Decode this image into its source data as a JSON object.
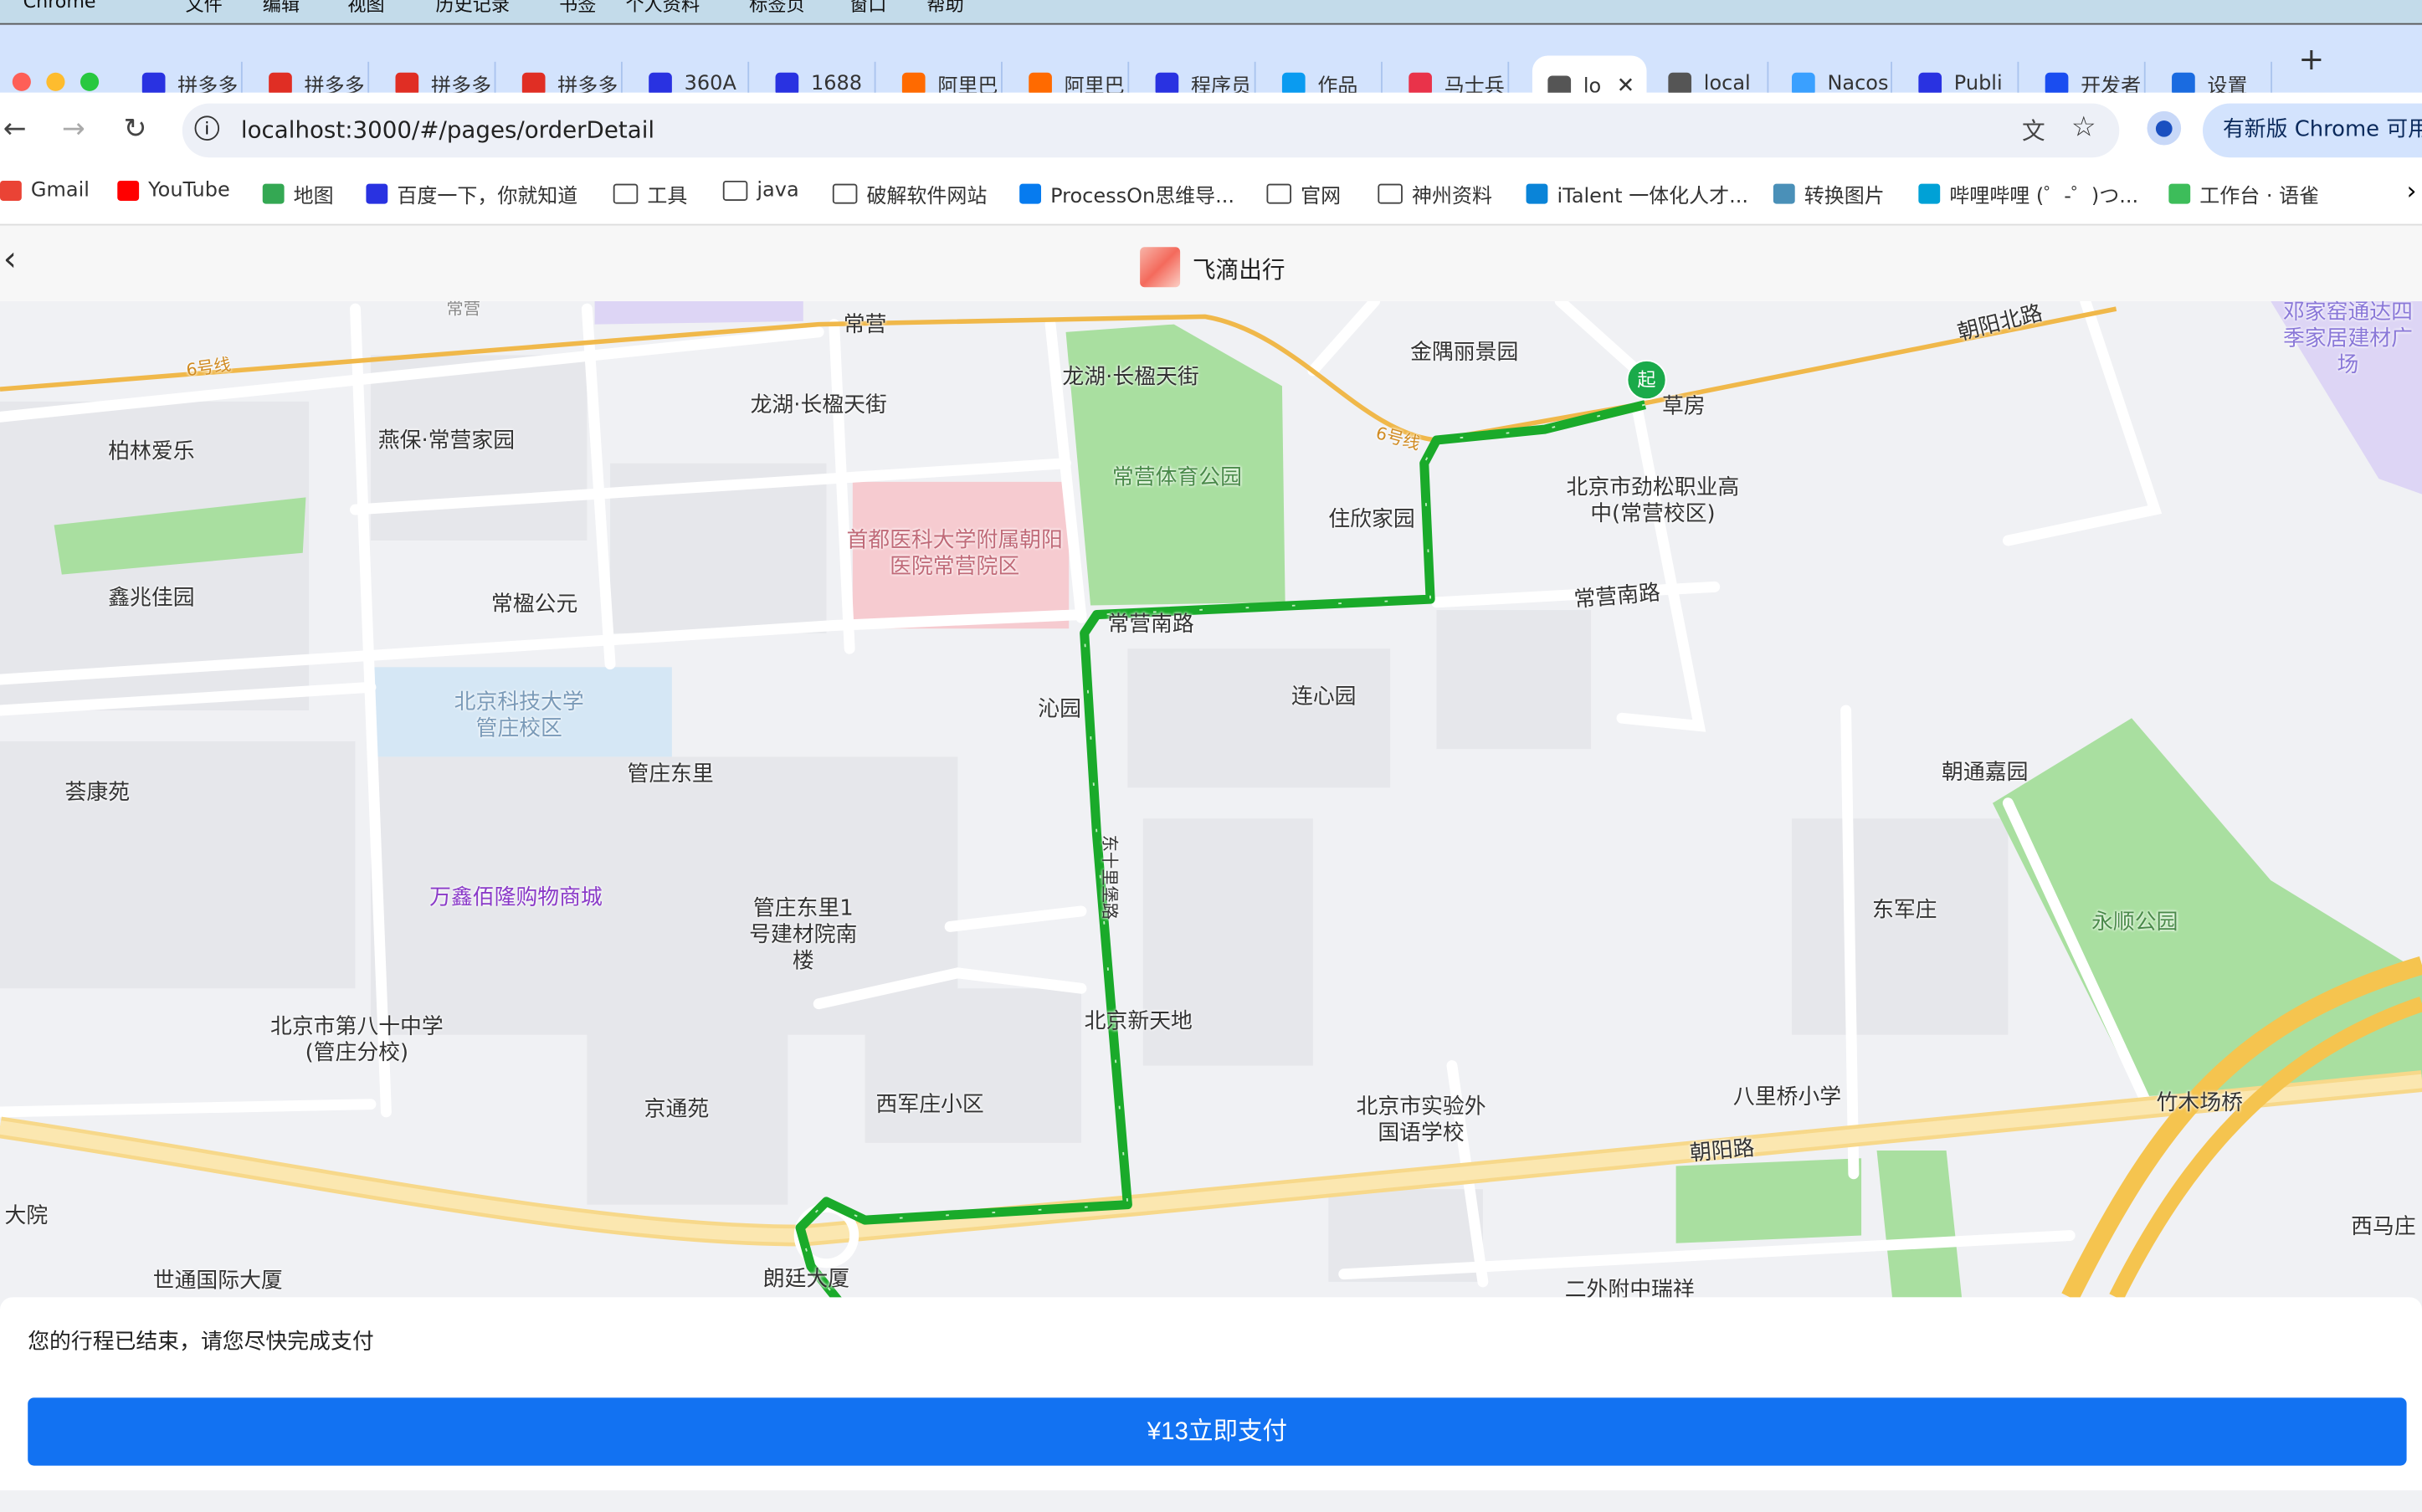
{
  "menubar": {
    "items": [
      "Chrome",
      "文件",
      "编辑",
      "视图",
      "历史记录",
      "书签",
      "个人资料",
      "标签页",
      "窗口",
      "帮助"
    ]
  },
  "tabs": [
    {
      "label": "拼多多",
      "icon": "baidu-icon",
      "color": "#2932e1"
    },
    {
      "label": "拼多多",
      "icon": "pinduoduo-icon",
      "color": "#e02e24"
    },
    {
      "label": "拼多多",
      "icon": "pinduoduo-icon",
      "color": "#e02e24"
    },
    {
      "label": "拼多多",
      "icon": "pinduoduo-icon",
      "color": "#e02e24"
    },
    {
      "label": "360A",
      "icon": "baidu-icon",
      "color": "#2932e1"
    },
    {
      "label": "1688",
      "icon": "baidu-icon",
      "color": "#2932e1"
    },
    {
      "label": "阿里巴",
      "icon": "alibaba-icon",
      "color": "#ff6a00"
    },
    {
      "label": "阿里巴",
      "icon": "alibaba-icon",
      "color": "#ff6a00"
    },
    {
      "label": "程序员",
      "icon": "baidu-icon",
      "color": "#2932e1"
    },
    {
      "label": "作品",
      "icon": "terminal-icon",
      "color": "#0a9bf0"
    },
    {
      "label": "马士兵",
      "icon": "mashibing-icon",
      "color": "#e9334a"
    },
    {
      "label": "lo",
      "icon": "globe-icon",
      "color": "#555555",
      "active": true
    },
    {
      "label": "local",
      "icon": "globe-icon",
      "color": "#555555"
    },
    {
      "label": "Nacos",
      "icon": "nacos-icon",
      "color": "#3aa0ff"
    },
    {
      "label": "Publi",
      "icon": "baidu-icon",
      "color": "#2932e1"
    },
    {
      "label": "开发者",
      "icon": "dev-icon",
      "color": "#1a4df0"
    },
    {
      "label": "设置",
      "icon": "gear-icon",
      "color": "#1a6be0"
    }
  ],
  "address": {
    "url": "localhost:3000/#/pages/orderDetail",
    "update_label": "有新版 Chrome 可用"
  },
  "bookmarks": [
    {
      "label": "Gmail",
      "color": "#ea4335"
    },
    {
      "label": "YouTube",
      "color": "#ff0000"
    },
    {
      "label": "地图",
      "color": "#34a853"
    },
    {
      "label": "百度一下，你就知道",
      "color": "#2932e1"
    },
    {
      "label": "工具",
      "folder": true
    },
    {
      "label": "java",
      "folder": true
    },
    {
      "label": "破解软件网站",
      "folder": true
    },
    {
      "label": "ProcessOn思维导...",
      "color": "#067bef"
    },
    {
      "label": "官网",
      "folder": true
    },
    {
      "label": "神州资料",
      "folder": true
    },
    {
      "label": "iTalent 一体化人才...",
      "color": "#0a84d8"
    },
    {
      "label": "转换图片",
      "color": "#4a90b8"
    },
    {
      "label": "哔哩哔哩 (゜-゜)つ...",
      "color": "#00a1d6"
    },
    {
      "label": "工作台 · 语雀",
      "color": "#3dbd5a"
    }
  ],
  "page": {
    "title": "飞滴出行"
  },
  "map": {
    "start_marker": "起",
    "labels": [
      "常营",
      "龙湖·长楹天街",
      "龙湖·长楹天街",
      "金隅丽景园",
      "草房",
      "朝阳北路",
      "邓家窑通达四季家居建材广场",
      "柏林爱乐",
      "燕保·常营家园",
      "常营体育公园",
      "首都医科大学附属朝阳医院常营院区",
      "住欣家园",
      "北京市劲松职业高中(常营校区)",
      "鑫兆佳园",
      "常楹公元",
      "常营南路",
      "常营南路",
      "北京科技大学管庄校区",
      "沁园",
      "连心园",
      "朝通嘉园",
      "荟康苑",
      "管庄东里",
      "万鑫佰隆购物商城",
      "管庄东里1号建材院南楼",
      "东军庄",
      "永顺公园",
      "北京市第八十中学(管庄分校)",
      "北京新天地",
      "京通苑",
      "西军庄小区",
      "北京市实验外国语学校",
      "八里桥小学",
      "竹木场桥",
      "朝阳路",
      "大院",
      "世通国际大厦",
      "朗廷大厦",
      "西马庄",
      "二外附中瑞祥",
      "6号线",
      "6号线",
      "常营",
      "东十里堡路"
    ],
    "route_color": "#1aaa2a"
  },
  "order": {
    "message": "您的行程已结束，请您尽快完成支付",
    "pay_label": "¥13立即支付",
    "button_color": "#1272f2"
  }
}
